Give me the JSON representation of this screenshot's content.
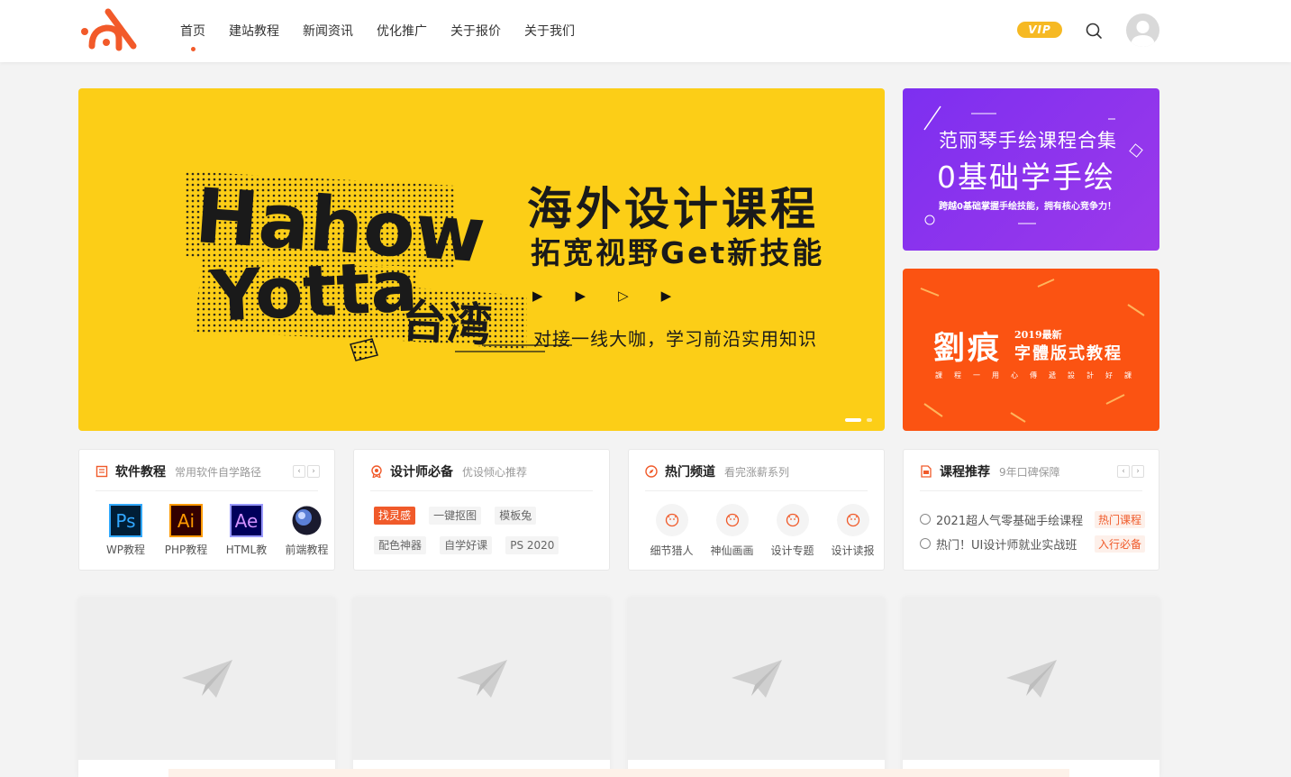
{
  "header": {
    "nav": [
      "首页",
      "建站教程",
      "新闻资讯",
      "优化推广",
      "关于报价",
      "关于我们"
    ],
    "vip_label": "VIP",
    "accent": "#f25a2a"
  },
  "banner_main": {
    "hahow_word": "Hahow",
    "yotta_word": "Yotta",
    "taiwan_word": "台湾",
    "title": "海外设计课程",
    "subtitle": "拓宽视野Get新技能",
    "description": "对接一线大咖，学习前沿实用知识",
    "bg_color": "#fcce17"
  },
  "banner_purple": {
    "line1": "范丽琴手绘课程合集",
    "line2": "0基础学手绘",
    "line3": "跨越0基础掌握手绘技能，拥有核心竞争力！"
  },
  "banner_orange": {
    "big": "劉痕",
    "year": "2019最新",
    "sub": "字體版式教程",
    "line": "課程一用心傳遞設計好課"
  },
  "cards": {
    "software": {
      "title": "软件教程",
      "subtitle": "常用软件自学路径",
      "items": [
        {
          "abbr": "Ps",
          "label": "WP教程"
        },
        {
          "abbr": "Ai",
          "label": "PHP教程"
        },
        {
          "abbr": "Ae",
          "label": "HTML教"
        },
        {
          "abbr": "",
          "label": "前端教程"
        }
      ]
    },
    "designer": {
      "title": "设计师必备",
      "subtitle": "优设倾心推荐",
      "tags": [
        "找灵感",
        "一键抠图",
        "模板兔",
        "配色神器",
        "自学好课",
        "PS 2020"
      ]
    },
    "hot": {
      "title": "热门频道",
      "subtitle": "看完涨薪系列",
      "channels": [
        "细节猎人",
        "神仙画画",
        "设计专题",
        "设计读报"
      ]
    },
    "courses": {
      "title": "课程推荐",
      "subtitle": "9年口碑保障",
      "items": [
        {
          "text": "2021超人气零基础手绘课程",
          "badge": "热门课程"
        },
        {
          "text": "热门！UI设计师就业实战班",
          "badge": "入行必备"
        }
      ]
    }
  }
}
